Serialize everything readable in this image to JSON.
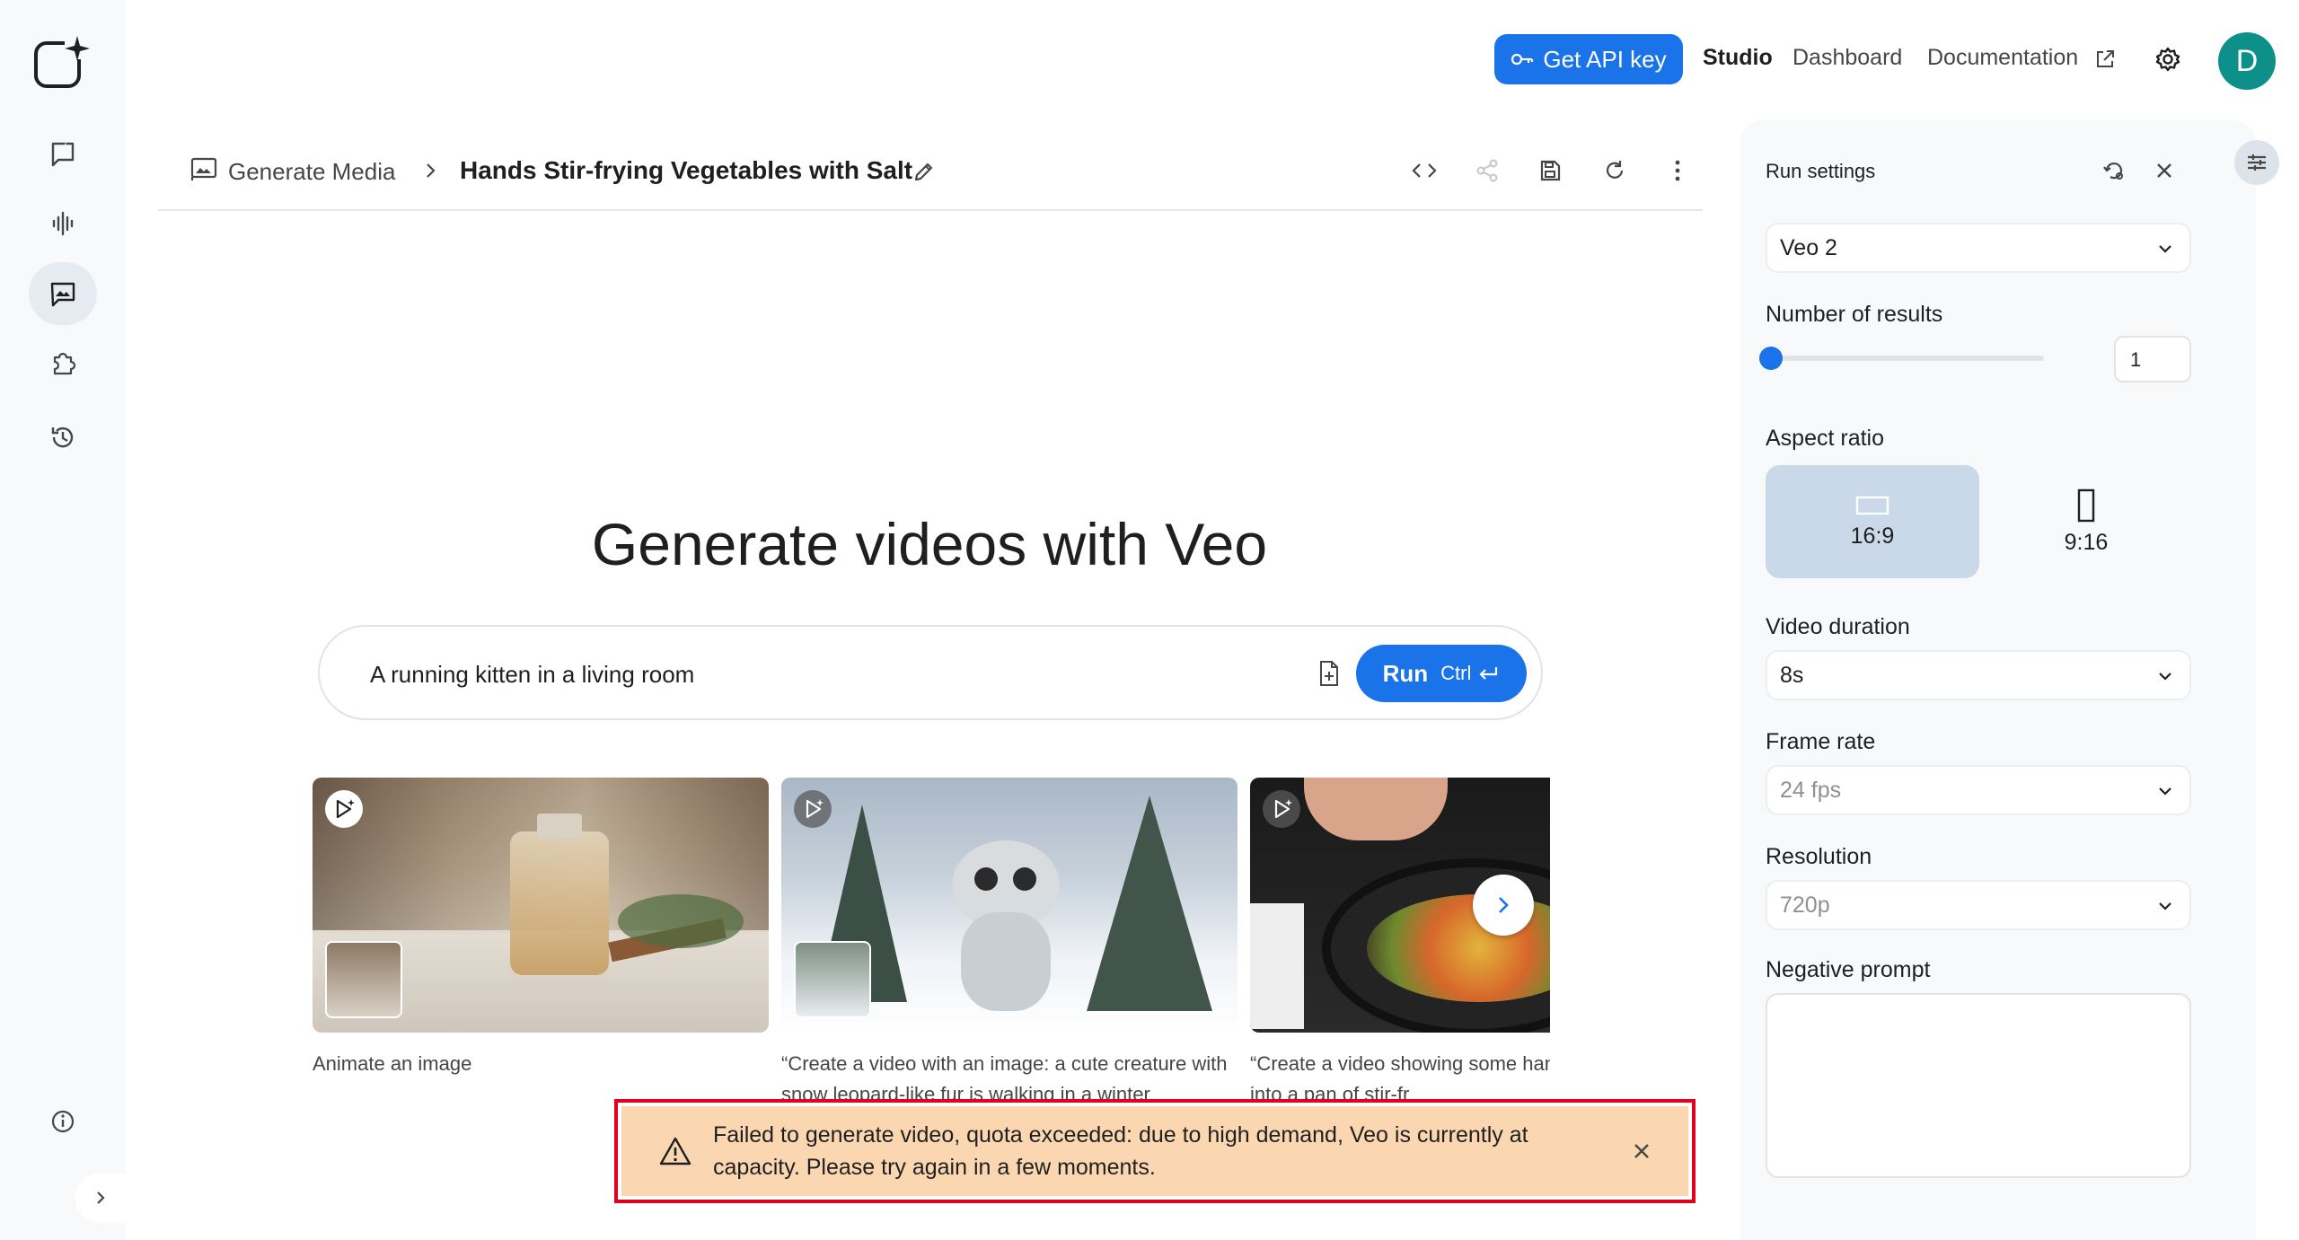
{
  "nav": {
    "items": [
      {
        "name": "chat",
        "icon": "chat-icon"
      },
      {
        "name": "stream",
        "icon": "audio-wave-icon"
      },
      {
        "name": "generate-media",
        "icon": "media-icon",
        "active": true
      },
      {
        "name": "build",
        "icon": "puzzle-icon"
      },
      {
        "name": "history",
        "icon": "history-icon"
      }
    ]
  },
  "topbar": {
    "api_key_label": "Get API key",
    "studio_label": "Studio",
    "dashboard_label": "Dashboard",
    "documentation_label": "Documentation",
    "avatar_letter": "D"
  },
  "header": {
    "breadcrumb": "Generate Media",
    "title": "Hands Stir-frying Vegetables with Salt"
  },
  "hero": {
    "title": "Generate videos with Veo",
    "prompt_value": "A running kitten in a living room",
    "run_label": "Run",
    "run_shortcut": "Ctrl"
  },
  "cards": [
    {
      "caption": "Animate an image"
    },
    {
      "caption": "“Create a video with an image: a cute creature with snow leopard-like fur is walking in a winter"
    },
    {
      "caption": "“Create a video showing some hands sprinkling salt into a pan of stir-fr"
    }
  ],
  "toast": {
    "message": "Failed to generate video, quota exceeded: due to high demand, Veo is currently at capacity. Please try again in a few moments."
  },
  "settings": {
    "title": "Run settings",
    "model": "Veo 2",
    "num_results_label": "Number of results",
    "num_results_value": "1",
    "num_results_fraction": 0,
    "aspect_ratio_label": "Aspect ratio",
    "aspect_options": [
      {
        "label": "16:9",
        "selected": true
      },
      {
        "label": "9:16",
        "selected": false
      }
    ],
    "duration_label": "Video duration",
    "duration_value": "8s",
    "frame_rate_label": "Frame rate",
    "frame_rate_value": "24 fps",
    "resolution_label": "Resolution",
    "resolution_value": "720p",
    "negative_prompt_label": "Negative prompt",
    "negative_prompt_value": ""
  },
  "colors": {
    "accent": "#1a73e8",
    "avatar": "#0d8f8a",
    "error_border": "#e3001b",
    "toast_bg": "#fbd7b1",
    "selected_option": "#c9d9ea"
  }
}
